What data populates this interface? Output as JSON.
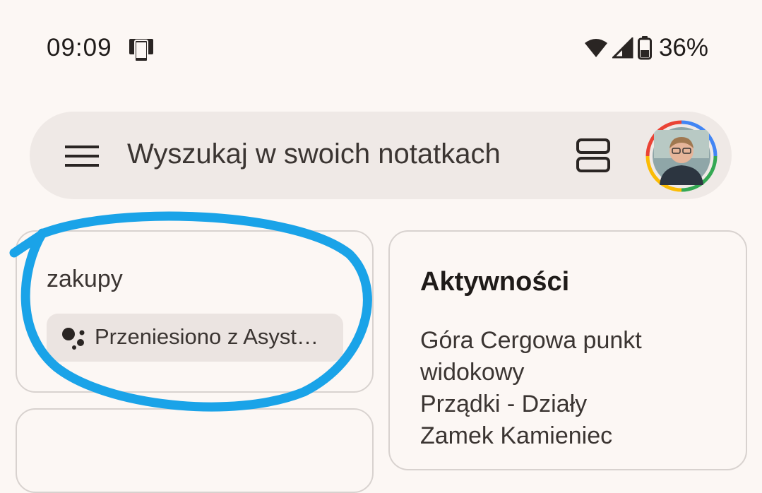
{
  "status_bar": {
    "time": "09:09",
    "battery_percent": "36%",
    "icons": [
      "device-icon",
      "wifi-icon",
      "signal-icon",
      "battery-icon"
    ]
  },
  "search": {
    "placeholder": "Wyszukaj w swoich notatkach"
  },
  "notes": [
    {
      "text": "zakupy",
      "chip_label": "Przeniesiono z Asyst…",
      "chip_icon": "assistant-icon"
    },
    {
      "title": "Aktywności",
      "lines": [
        "Góra Cergowa punkt",
        "widokowy",
        "Prządki - Działy",
        "Zamek Kamieniec"
      ]
    }
  ],
  "colors": {
    "background": "#fcf7f4",
    "search_bar": "#efe9e6",
    "highlight": "#1aa3e8"
  }
}
